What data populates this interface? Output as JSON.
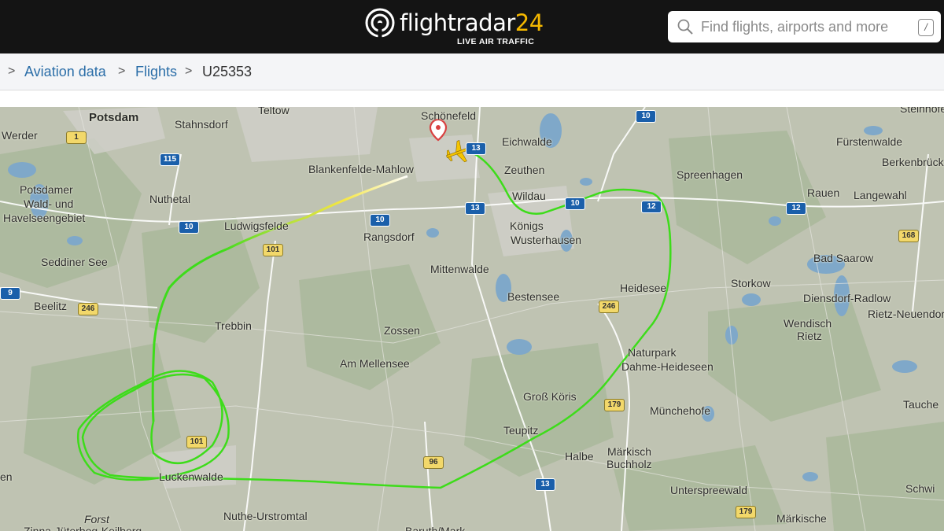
{
  "header": {
    "logo_text": "flightradar",
    "logo_number": "24",
    "logo_subtitle": "LIVE AIR TRAFFIC",
    "search_placeholder": "Find flights, airports and more",
    "search_shortcut": "/"
  },
  "breadcrumb": {
    "items": [
      {
        "label": "Aviation data",
        "link": true
      },
      {
        "label": "Flights",
        "link": true
      },
      {
        "label": "U25353",
        "link": false
      }
    ],
    "separator": ">"
  },
  "map": {
    "colors": {
      "track_start": "#ffffff",
      "track_mid": "#f5e642",
      "track_main": "#3ddc1a",
      "aircraft": "#f5c400",
      "pin": "#d94141",
      "road_major": "#ffffff",
      "water": "#7fa8c9"
    },
    "place_labels": [
      "Potsdam",
      "Werder",
      "Stahnsdorf",
      "Teltow",
      "Schönefeld",
      "Eichwalde",
      "Steinhöfel",
      "Fürstenwalde",
      "Blankenfelde-Mahlow",
      "Zeuthen",
      "Spreenhagen",
      "Berkenbrück",
      "Potsdamer",
      "Wald- und",
      "Havelseengebiet",
      "Nuthetal",
      "Wildau",
      "Rauen",
      "Langewahl",
      "Ludwigsfelde",
      "Rangsdorf",
      "Königs",
      "Wusterhausen",
      "Seddiner See",
      "Bad Saarow",
      "Mittenwalde",
      "Storkow",
      "Heidesee",
      "Beelitz",
      "Bestensee",
      "Diensdorf-Radlow",
      "Rietz-Neuendorf",
      "Trebbin",
      "Wendisch",
      "Rietz",
      "Zossen",
      "Naturpark",
      "Dahme-Heideseen",
      "Am Mellensee",
      "Groß Köris",
      "Münchehofe",
      "Tauche",
      "Teupitz",
      "Halbe",
      "Märkisch",
      "Buchholz",
      "Luckenwalde",
      "Unterspreewald",
      "Schwi",
      "Forst",
      "Nuthe-Urstromtal",
      "Märkische",
      "Zinna-Jüterbog-Keilberg",
      "Baruth/Mark",
      "en"
    ],
    "road_shields": [
      {
        "num": "1",
        "type": "federal"
      },
      {
        "num": "115",
        "type": "motorway"
      },
      {
        "num": "10",
        "type": "motorway"
      },
      {
        "num": "13",
        "type": "motorway"
      },
      {
        "num": "12",
        "type": "motorway"
      },
      {
        "num": "101",
        "type": "federal"
      },
      {
        "num": "168",
        "type": "federal"
      },
      {
        "num": "246",
        "type": "federal"
      },
      {
        "num": "9",
        "type": "motorway"
      },
      {
        "num": "179",
        "type": "federal"
      },
      {
        "num": "96",
        "type": "federal"
      }
    ]
  }
}
